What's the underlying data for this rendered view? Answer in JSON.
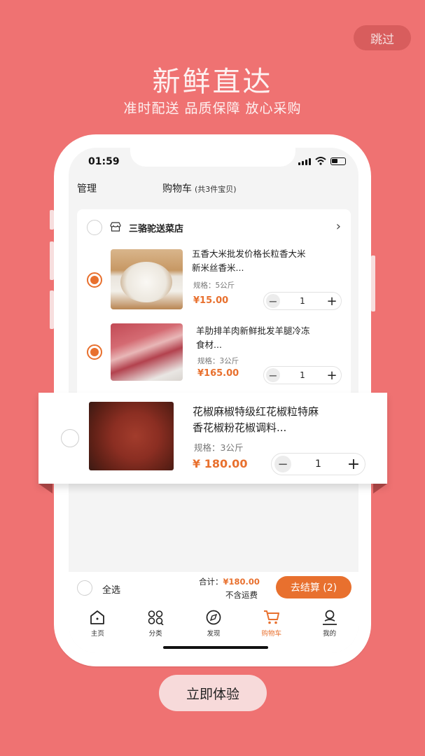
{
  "skip_label": "跳过",
  "hero": {
    "title": "新鲜直达",
    "subtitle": "准时配送 品质保障 放心采购"
  },
  "status": {
    "time": "01:59"
  },
  "header": {
    "manage": "管理",
    "title": "购物车",
    "count": "(共3件宝贝)"
  },
  "store": {
    "name": "三骆驼送菜店"
  },
  "items": [
    {
      "title_line1": "五香大米批发价格长粒香大米",
      "title_line2": "新米丝香米...",
      "spec": "规格：5公斤",
      "price": "¥15.00",
      "qty": "1",
      "checked": true
    },
    {
      "title_line1": "羊肋排羊肉新鲜批发羊腿冷冻",
      "title_line2": "食材...",
      "spec": "规格：3公斤",
      "price": "¥165.00",
      "qty": "1",
      "checked": true
    },
    {
      "title_line1": "花椒麻椒特级红花椒粒特麻",
      "title_line2": "香花椒粉花椒调料...",
      "spec": "规格：3公斤",
      "price": "¥ 180.00",
      "qty": "1",
      "checked": false
    }
  ],
  "footer": {
    "select_all": "全选",
    "total_label": "合计：",
    "total_value": "¥180.00",
    "shipping": "不含运费",
    "checkout": "去结算 (2)"
  },
  "tabs": [
    {
      "label": "主页",
      "icon": "home-icon"
    },
    {
      "label": "分类",
      "icon": "category-icon"
    },
    {
      "label": "发现",
      "icon": "discover-icon"
    },
    {
      "label": "购物车",
      "icon": "cart-icon",
      "active": true
    },
    {
      "label": "我的",
      "icon": "profile-icon"
    }
  ],
  "cta_label": "立即体验",
  "colors": {
    "background": "#ef7272",
    "accent": "#e8702e"
  }
}
